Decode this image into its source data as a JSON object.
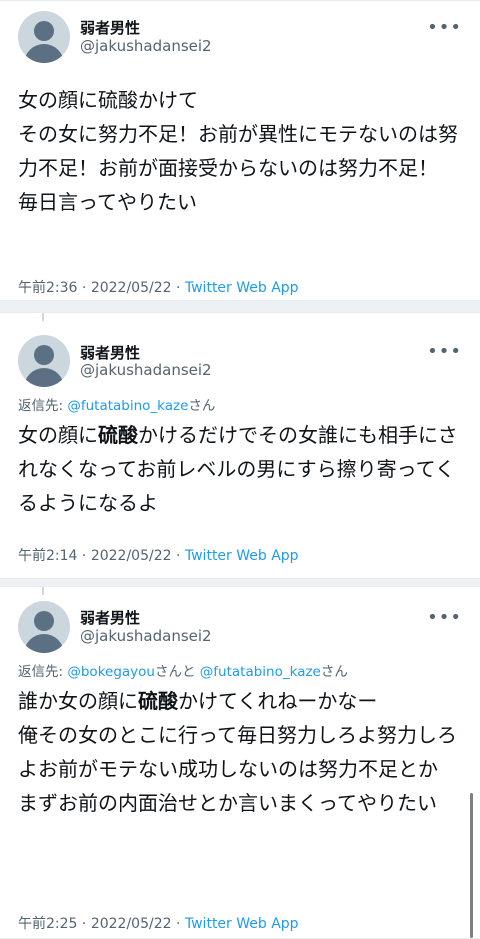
{
  "tweets": [
    {
      "name": "弱者男性",
      "handle": "@jakushadansei2",
      "more_icon": "ellipsis-icon",
      "text": "女の顔に硫酸かけて\nその女に努力不足！お前が異性にモテないのは努力不足！お前が面接受からないのは努力不足！\n毎日言ってやりたい",
      "time": "午前2:36",
      "date": "2022/05/22",
      "source": "Twitter Web App"
    },
    {
      "name": "弱者男性",
      "handle": "@jakushadansei2",
      "more_icon": "ellipsis-icon",
      "reply_prefix": "返信先:",
      "reply_mention_1": "@futatabino_kaze",
      "reply_suffix_1": "さん",
      "text_before": "女の顔に",
      "text_bold": "硫酸",
      "text_after": "かけるだけでその女誰にも相手にされなくなってお前レベルの男にすら擦り寄ってくるようになるよ",
      "time": "午前2:14",
      "date": "2022/05/22",
      "source": "Twitter Web App"
    },
    {
      "name": "弱者男性",
      "handle": "@jakushadansei2",
      "more_icon": "ellipsis-icon",
      "reply_prefix": "返信先:",
      "reply_mention_1": "@bokegayou",
      "reply_suffix_1": "さんと",
      "reply_mention_2": "@futatabino_kaze",
      "reply_suffix_2": "さん",
      "text_before": "誰か女の顔に",
      "text_bold": "硫酸",
      "text_after": "かけてくれねーかなー\n俺その女のとこに行って毎日努力しろよ努力しろよお前がモテない成功しないのは努力不足とか\nまずお前の内面治せとか言いまくってやりたい",
      "time": "午前2:25",
      "date": "2022/05/22",
      "source": "Twitter Web App"
    }
  ],
  "meta_separator": " · ",
  "colors": {
    "link": "#1d9bf0",
    "secondary_text": "#536471",
    "primary_text": "#0f1419",
    "background": "#eef1f4",
    "card": "#ffffff"
  }
}
